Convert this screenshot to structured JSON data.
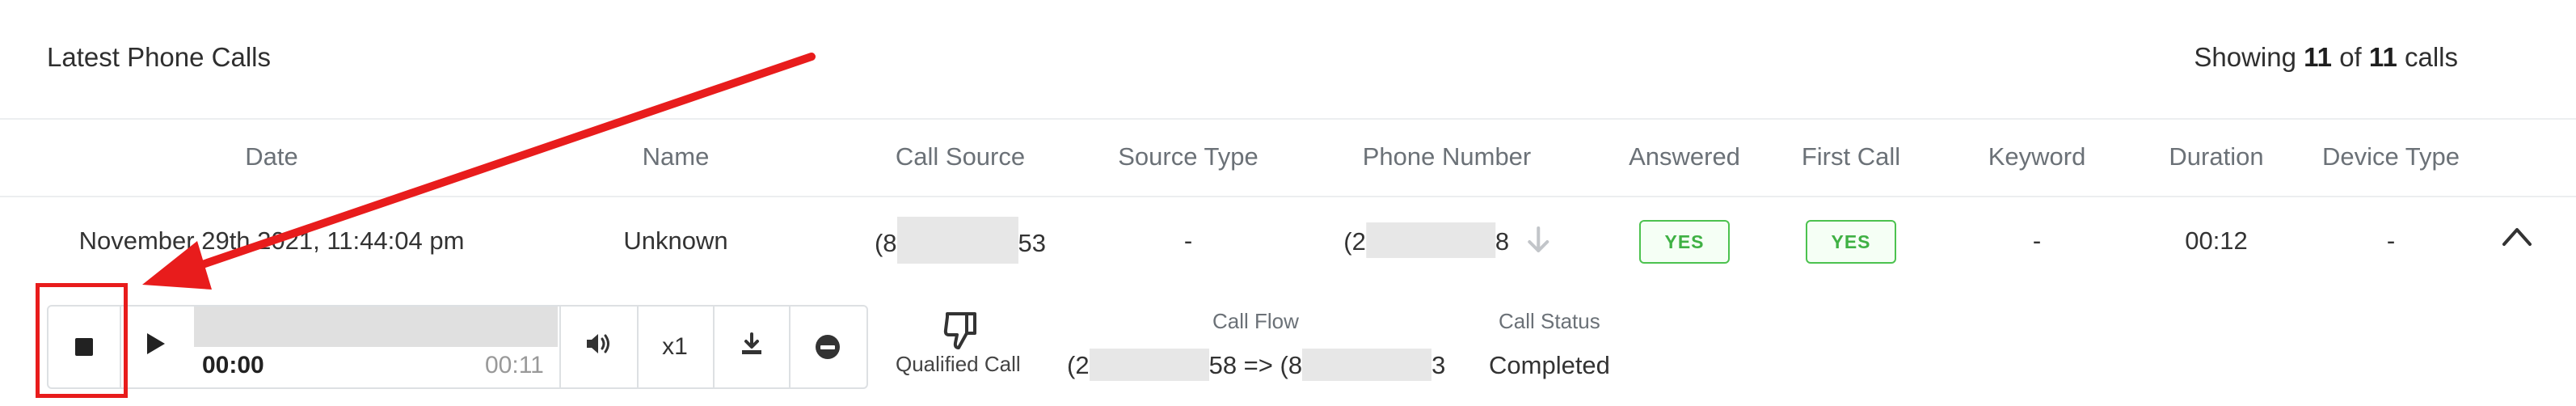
{
  "header": {
    "title": "Latest Phone Calls",
    "showing_prefix": "Showing",
    "showing_count": "11",
    "showing_of": "of",
    "showing_total": "11",
    "showing_suffix": "calls"
  },
  "columns": [
    "Date",
    "Name",
    "Call Source",
    "Source Type",
    "Phone Number",
    "Answered",
    "First Call",
    "Keyword",
    "Duration",
    "Device Type"
  ],
  "row": {
    "date": "November 29th 2021, 11:44:04 pm",
    "name": "Unknown",
    "call_source_start": "(8",
    "call_source_end": "53",
    "source_type": "-",
    "phone_start": "(2",
    "phone_end": "8",
    "answered": "YES",
    "first_call": "YES",
    "keyword": "-",
    "duration": "00:12",
    "device_type": "-"
  },
  "player": {
    "current_time": "00:00",
    "total_time": "00:11",
    "speed": "x1",
    "progress": 0
  },
  "details": {
    "qualified_label": "Qualified Call",
    "call_flow_label": "Call Flow",
    "call_flow_start": "(2",
    "call_flow_mid": "58 => (8",
    "call_flow_end": "3",
    "call_status_label": "Call Status",
    "call_status_value": "Completed"
  },
  "colors": {
    "badge_green": "#3fb144",
    "annotation_red": "#e81c1c"
  }
}
